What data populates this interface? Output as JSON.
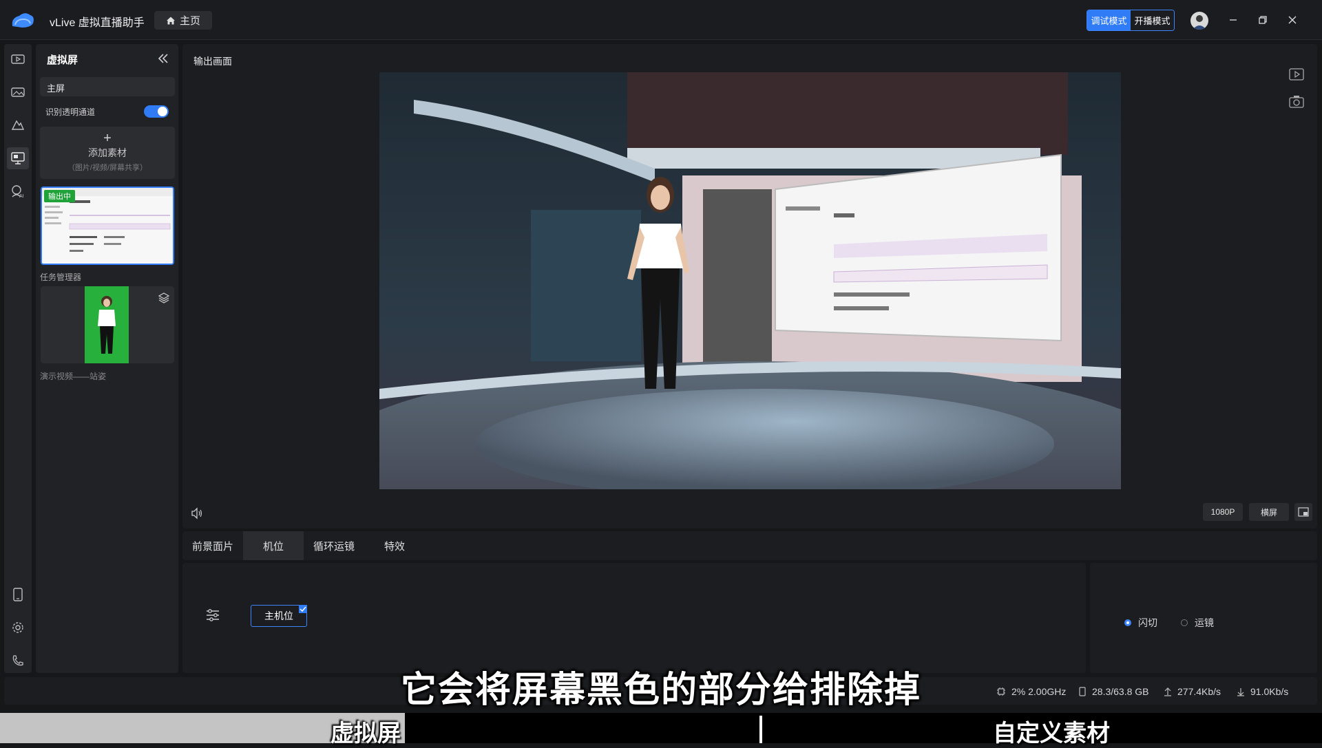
{
  "titlebar": {
    "app_title": "vLive 虚拟直播助手",
    "home_label": "主页",
    "mode_debug": "调试模式",
    "mode_live": "开播模式"
  },
  "panel": {
    "title": "虚拟屏",
    "main_screen": "主屏",
    "toggle_label": "识别透明通道",
    "toggle_on": true,
    "add_plus": "+",
    "add_label": "添加素材",
    "add_hint": "（图片/视频/屏幕共享）",
    "badge": "输出中",
    "item1_caption": "任务管理器",
    "item2_caption": "演示视频——站姿"
  },
  "output": {
    "title": "输出画面",
    "resolution": "1080P",
    "orientation": "横屏"
  },
  "tabs": [
    {
      "label": "前景面片"
    },
    {
      "label": "机位"
    },
    {
      "label": "循环运镜"
    },
    {
      "label": "特效"
    }
  ],
  "camera": {
    "main_label": "主机位"
  },
  "transition": {
    "flash": "闪切",
    "move": "运镜"
  },
  "status": {
    "cpu": "2% 2.00GHz",
    "memory": "28.3/63.8 GB",
    "upload": "277.4Kb/s",
    "download": "91.0Kb/s"
  },
  "overlay": {
    "subtitle": "它会将屏幕黑色的部分给排除掉",
    "band_left": "虚拟屏",
    "band_right": "自定义素材"
  },
  "colors": {
    "accent": "#2f7cf6",
    "live_badge": "#1fa339"
  }
}
